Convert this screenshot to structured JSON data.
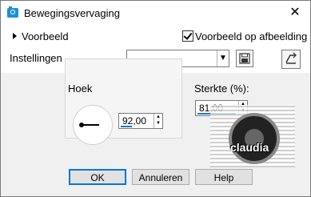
{
  "window": {
    "title": "Bewegingsvervaging"
  },
  "preview": {
    "label": "Voorbeeld",
    "checkbox_label": "Voorbeeld op afbeelding",
    "checked": true
  },
  "settings": {
    "label": "Instellingen",
    "value": ""
  },
  "angle": {
    "label": "Hoek",
    "value": "92,00"
  },
  "strength": {
    "label": "Sterkte (%):",
    "value": "81,00"
  },
  "watermark": {
    "text": "claudia"
  },
  "buttons": {
    "ok": "OK",
    "cancel": "Annuleren",
    "help": "Help"
  }
}
